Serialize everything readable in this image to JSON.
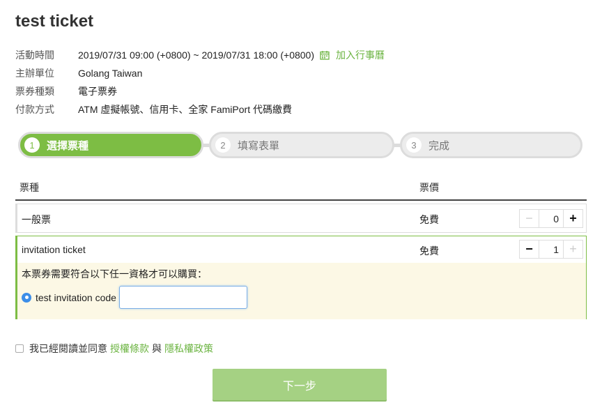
{
  "page": {
    "title": "test ticket"
  },
  "info": {
    "time_label": "活動時間",
    "time_value": "2019/07/31 09:00 (+0800) ~ 2019/07/31 18:00 (+0800)",
    "calendar_label": "加入行事曆",
    "organizer_label": "主辦單位",
    "organizer_value": "Golang Taiwan",
    "ticket_type_label": "票券種類",
    "ticket_type_value": "電子票券",
    "payment_label": "付款方式",
    "payment_value": "ATM 虛擬帳號、信用卡、全家 FamiPort 代碼繳費"
  },
  "steps": [
    {
      "num": "1",
      "label": "選擇票種",
      "active": true
    },
    {
      "num": "2",
      "label": "填寫表單",
      "active": false
    },
    {
      "num": "3",
      "label": "完成",
      "active": false
    }
  ],
  "table": {
    "col_ticket": "票種",
    "col_price": "票價",
    "rows": [
      {
        "name": "一般票",
        "price": "免費",
        "quantity": "0"
      },
      {
        "name": "invitation ticket",
        "price": "免費",
        "quantity": "1"
      }
    ],
    "requirement_text": "本票券需要符合以下任一資格才可以購買：",
    "invitation_option": "test invitation code",
    "invitation_input_value": ""
  },
  "agree": {
    "text_prefix": "我已經閱讀並同意",
    "terms_link": "授權條款",
    "conjunction": "與",
    "privacy_link": "隱私權政策"
  },
  "next_button": "下一步",
  "colors": {
    "accent": "#7dbd44",
    "link": "#6cb442",
    "highlight_bg": "#fcf8e5"
  },
  "icons": {
    "calendar": "calendar-icon",
    "minus": "minus-icon",
    "plus": "plus-icon"
  }
}
